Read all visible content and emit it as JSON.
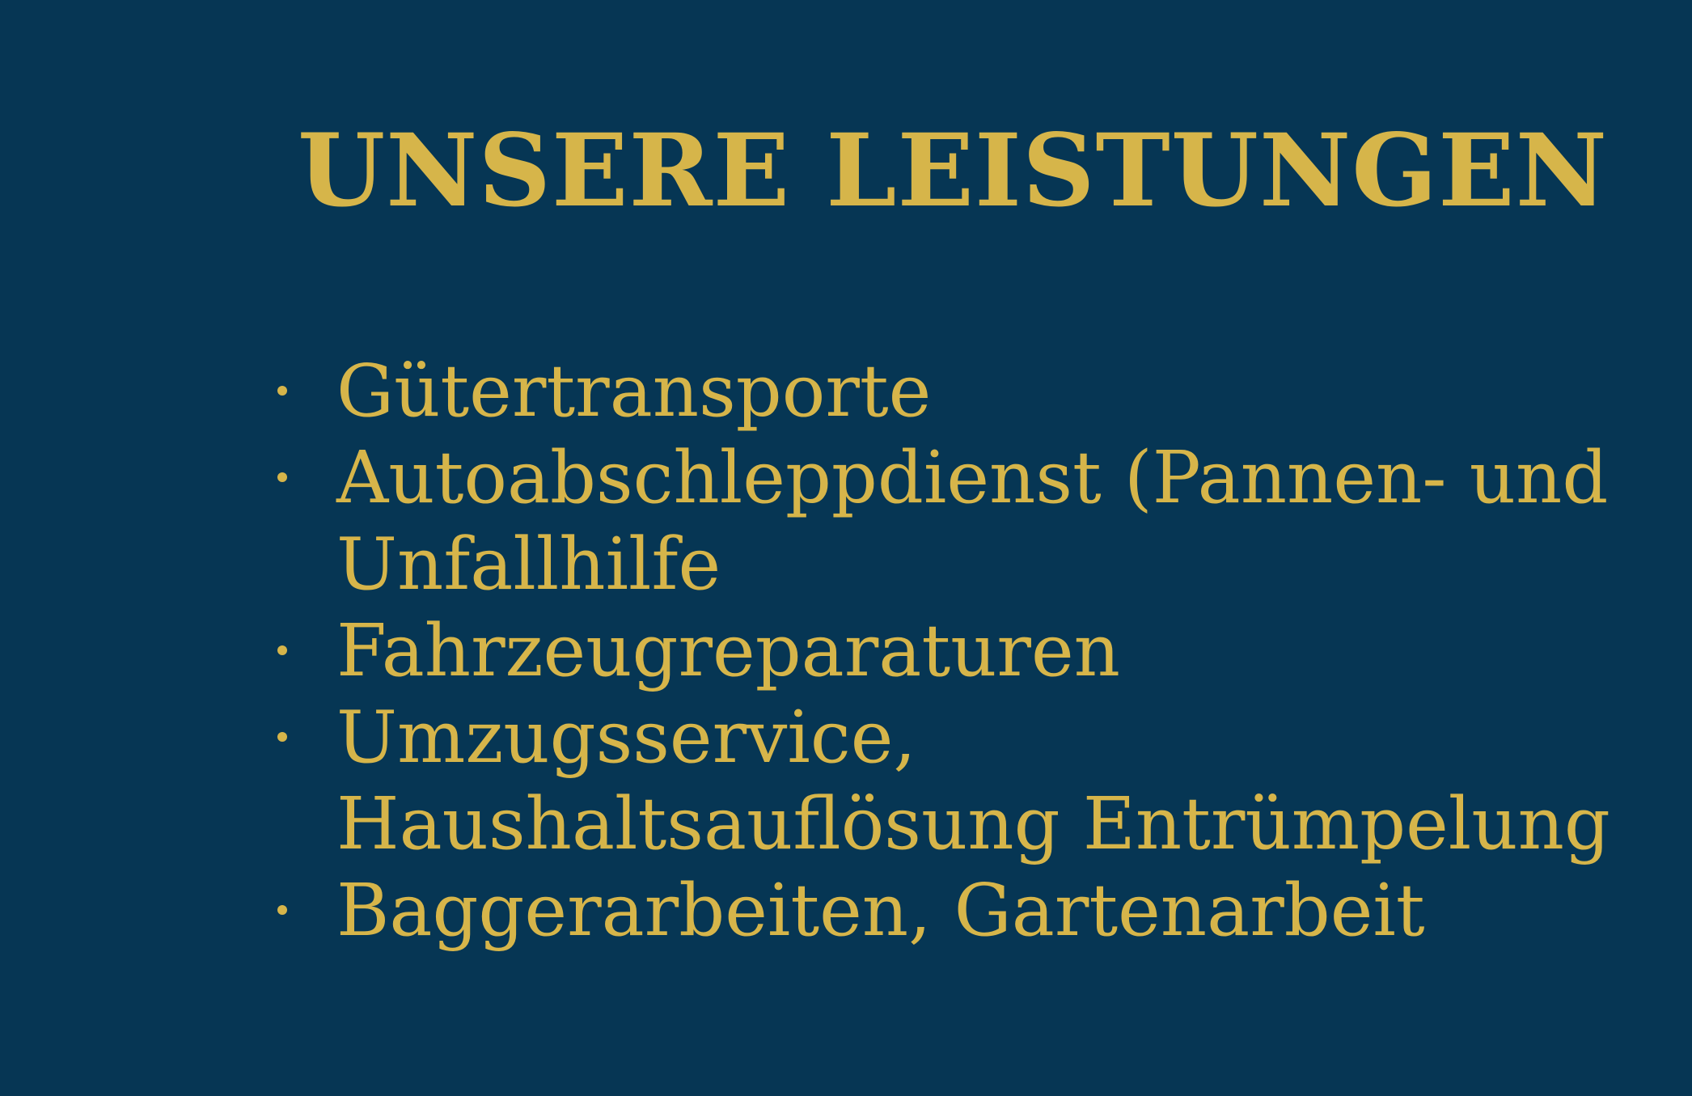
{
  "title": "UNSERE LEISTUNGEN",
  "services": [
    {
      "label": "Gütertransporte"
    },
    {
      "label": "Autoabschleppdienst (Pannen- und Unfallhilfe"
    },
    {
      "label": "Fahrzeugreparaturen"
    },
    {
      "label": "Umzugsservice, Haushaltsauflösung Entrümpelung"
    },
    {
      "label": "Baggerarbeiten, Gartenarbeit"
    }
  ],
  "colors": {
    "background": "#063654",
    "accent": "#D6B54A"
  }
}
